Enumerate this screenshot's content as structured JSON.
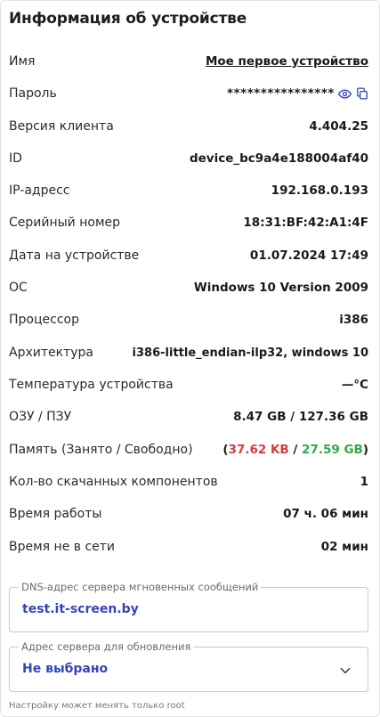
{
  "header": {
    "title": "Информация об устройстве"
  },
  "rows": {
    "name": {
      "label": "Имя",
      "value": "Мое первое устройство"
    },
    "password": {
      "label": "Пароль",
      "value": "****************"
    },
    "client_version": {
      "label": "Версия клиента",
      "value": "4.404.25"
    },
    "id": {
      "label": "ID",
      "value": "device_bc9a4e188004af40"
    },
    "ip": {
      "label": "IP-адресс",
      "value": "192.168.0.193"
    },
    "serial": {
      "label": "Серийный номер",
      "value": "18:31:BF:42:A1:4F"
    },
    "date": {
      "label": "Дата на устройстве",
      "value": "01.07.2024 17:49"
    },
    "os": {
      "label": "ОС",
      "value": "Windows 10 Version 2009"
    },
    "cpu": {
      "label": "Процессор",
      "value": "i386"
    },
    "arch": {
      "label": "Архитектура",
      "value": "i386-little_endian-ilp32, windows 10"
    },
    "temperature": {
      "label": "Температура устройства",
      "value": "—°C"
    },
    "ram_rom": {
      "label": "ОЗУ / ПЗУ",
      "value": "8.47 GB / 127.36 GB"
    },
    "memory": {
      "label": "Память (Занято / Свободно)",
      "open": "(",
      "used": "37.62 KB",
      "sep": " / ",
      "free": "27.59 GB",
      "close": ")"
    },
    "components": {
      "label": "Кол-во скачанных компонентов",
      "value": "1"
    },
    "uptime": {
      "label": "Время работы",
      "value": "07 ч. 06 мин"
    },
    "offline": {
      "label": "Время не в сети",
      "value": "02 мин"
    }
  },
  "dns_field": {
    "legend": "DNS-адрес сервера мгновенных сообщений",
    "value": "test.it-screen.by"
  },
  "update_field": {
    "legend": "Адрес сервера для обновления",
    "value": "Не выбрано"
  },
  "hint": "Настройку может менять только root",
  "colors": {
    "accent": "#3446b5",
    "used": "#d93b3b",
    "free": "#2eaa4a",
    "temperature": "#2eaa4a"
  },
  "icons": {
    "password_show": "eye-icon",
    "password_copy": "copy-icon",
    "dropdown": "chevron-down-icon"
  }
}
